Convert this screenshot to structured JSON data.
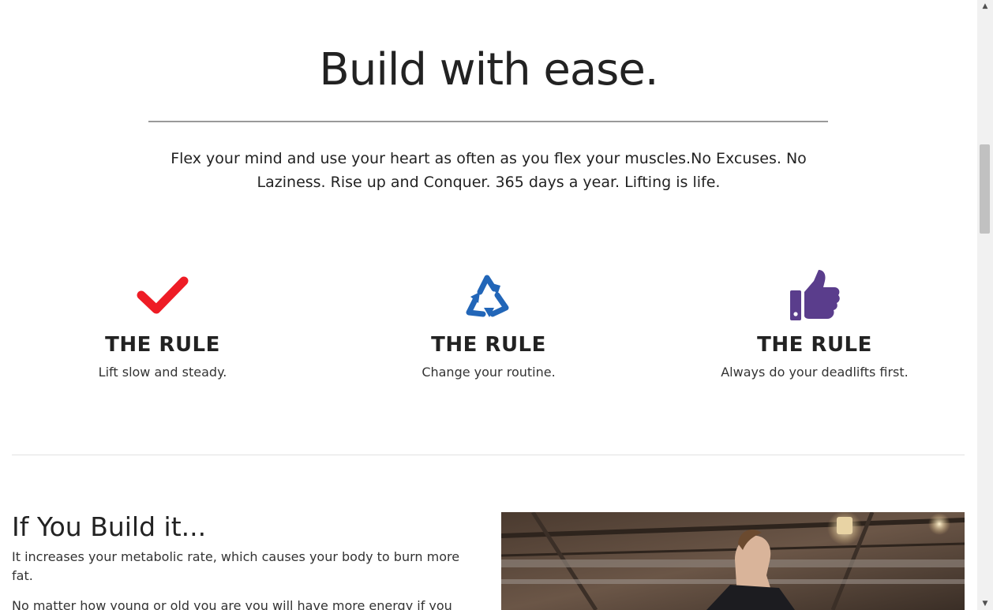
{
  "hero": {
    "title": "Build with ease.",
    "text": "Flex your mind and use your heart as often as you flex your muscles.No Excuses. No Laziness. Rise up and Conquer. 365 days a year. Lifting is life."
  },
  "features": [
    {
      "icon": "check-icon",
      "color": "#ee1c25",
      "title": "THE RULE",
      "text": "Lift slow and steady."
    },
    {
      "icon": "recycle-icon",
      "color": "#2266b8",
      "title": "THE RULE",
      "text": "Change your routine."
    },
    {
      "icon": "thumbs-up-icon",
      "color": "#5a3d8c",
      "title": "THE RULE",
      "text": "Always do your deadlifts first."
    }
  ],
  "about": {
    "title": "If You Build it...",
    "paragraph1": "It increases your metabolic rate, which causes your body to burn more fat.",
    "paragraph2": "No matter how young or old you are you will have more energy if you"
  }
}
